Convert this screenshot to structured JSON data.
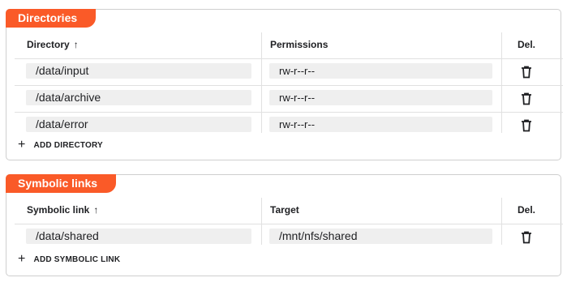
{
  "directories": {
    "title": "Directories",
    "columns": {
      "name": "Directory",
      "permissions": "Permissions",
      "delete": "Del."
    },
    "rows": [
      {
        "path": "/data/input",
        "permissions": "rw-r--r--"
      },
      {
        "path": "/data/archive",
        "permissions": "rw-r--r--"
      },
      {
        "path": "/data/error",
        "permissions": "rw-r--r--"
      }
    ],
    "add_label": "ADD DIRECTORY"
  },
  "symlinks": {
    "title": "Symbolic links",
    "columns": {
      "name": "Symbolic link",
      "target": "Target",
      "delete": "Del."
    },
    "rows": [
      {
        "link": "/data/shared",
        "target": "/mnt/nfs/shared"
      }
    ],
    "add_label": "ADD SYMBOLIC LINK"
  },
  "icons": {
    "sort": "arrow-up-icon",
    "delete": "trash-icon",
    "add": "plus-icon"
  },
  "colors": {
    "accent": "#fa5a28"
  }
}
